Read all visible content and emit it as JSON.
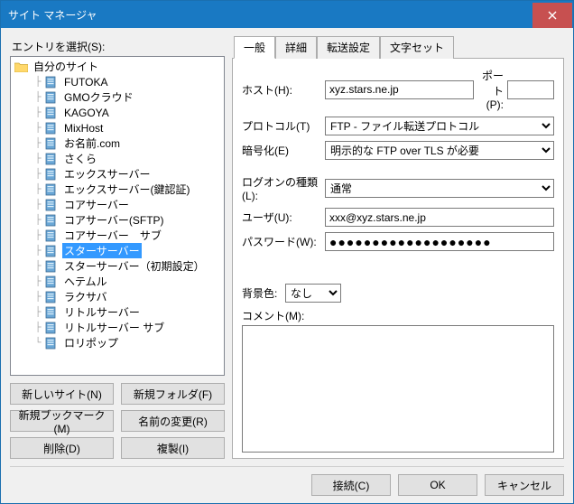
{
  "title": "サイト マネージャ",
  "left": {
    "select_label": "エントリを選択(S):",
    "root": "自分のサイト",
    "sites": [
      "FUTOKA",
      "GMOクラウド",
      "KAGOYA",
      "MixHost",
      "お名前.com",
      "さくら",
      "エックスサーバー",
      "エックスサーバー(鍵認証)",
      "コアサーバー",
      "コアサーバー(SFTP)",
      "コアサーバー　サブ",
      "スターサーバー",
      "スターサーバー（初期設定）",
      "ヘテムル",
      "ラクサバ",
      "リトルサーバー",
      "リトルサーバー サブ",
      "ロリポップ"
    ],
    "selected_index": 11,
    "buttons": {
      "new_site": "新しいサイト(N)",
      "new_folder": "新規フォルダ(F)",
      "new_bookmark": "新規ブックマーク(M)",
      "rename": "名前の変更(R)",
      "delete": "削除(D)",
      "duplicate": "複製(I)"
    }
  },
  "tabs": {
    "general": "一般",
    "advanced": "詳細",
    "transfer": "転送設定",
    "charset": "文字セット"
  },
  "form": {
    "host_label": "ホスト(H):",
    "host_value": "xyz.stars.ne.jp",
    "port_label": "ポート(P):",
    "port_value": "",
    "protocol_label": "プロトコル(T)",
    "protocol_value": "FTP - ファイル転送プロトコル",
    "encryption_label": "暗号化(E)",
    "encryption_value": "明示的な FTP over TLS が必要",
    "logon_label": "ログオンの種類(L):",
    "logon_value": "通常",
    "user_label": "ユーザ(U):",
    "user_value": "xxx@xyz.stars.ne.jp",
    "password_label": "パスワード(W):",
    "password_value": "●●●●●●●●●●●●●●●●●●●",
    "bgcolor_label": "背景色:",
    "bgcolor_value": "なし",
    "comment_label": "コメント(M):",
    "comment_value": ""
  },
  "footer": {
    "connect": "接続(C)",
    "ok": "OK",
    "cancel": "キャンセル"
  }
}
